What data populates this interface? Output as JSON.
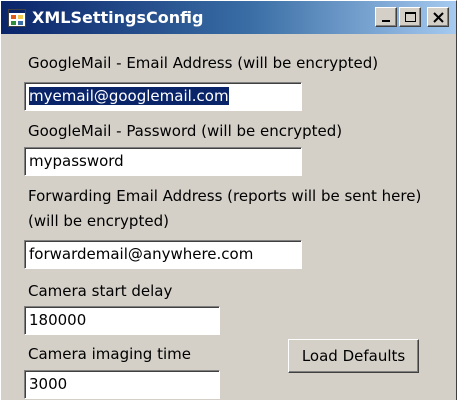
{
  "window": {
    "title": "XMLSettingsConfig",
    "title_icon": "form-icon",
    "controls": [
      "minimize-icon",
      "maximize-icon",
      "close-icon"
    ]
  },
  "fields": {
    "gmail_address": {
      "label": "GoogleMail - Email Address (will be encrypted)",
      "value": "myemail@googlemail.com"
    },
    "gmail_password": {
      "label": "GoogleMail - Password (will be encrypted)",
      "value": "mypassword"
    },
    "forward_address": {
      "label_line1": "Forwarding Email Address (reports will be sent here)",
      "label_line2": "(will be encrypted)",
      "value": "forwardemail@anywhere.com"
    },
    "camera_start_delay": {
      "label": "Camera start delay",
      "value": "180000"
    },
    "camera_imaging_time": {
      "label": "Camera imaging time",
      "value": "3000"
    }
  },
  "buttons": {
    "load_defaults": "Load Defaults"
  },
  "colors": {
    "titlebar_start": "#0a246a",
    "titlebar_end": "#a6caf0",
    "dialog_face": "#d4d0c8",
    "selection": "#0a246a"
  }
}
